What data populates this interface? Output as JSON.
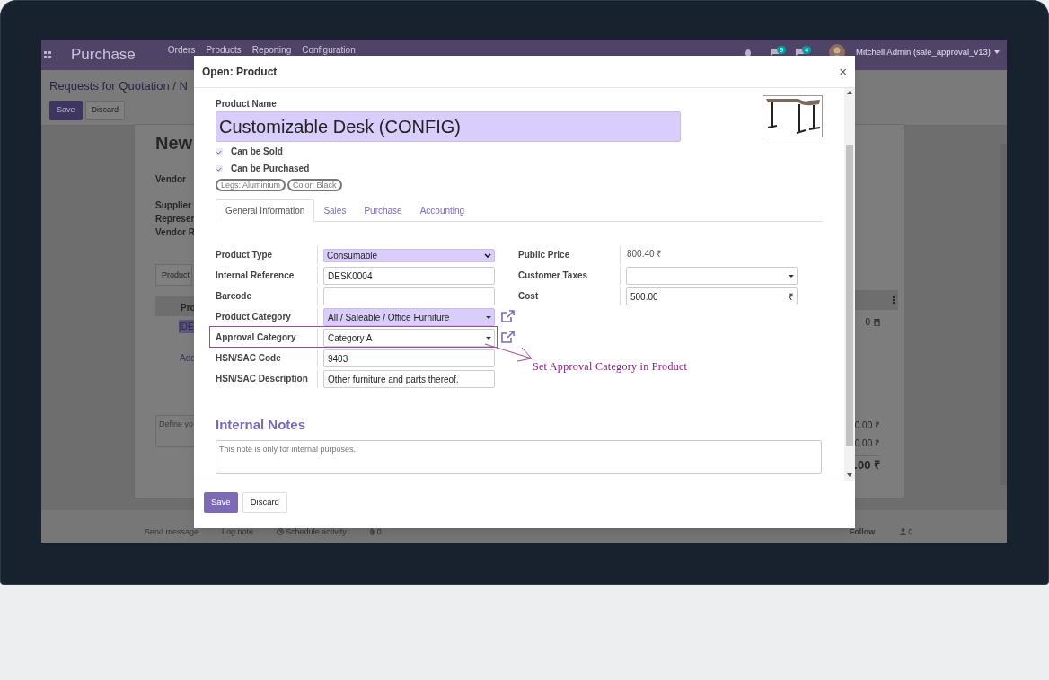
{
  "app": {
    "title": "Purchase",
    "menu": [
      "Orders",
      "Products",
      "Reporting",
      "Configuration"
    ],
    "badges": [
      "9",
      "4"
    ],
    "user": "Mitchell Admin (sale_approval_v13)"
  },
  "background": {
    "breadcrumb": "Requests for Quotation / N",
    "buttons": [
      "Save",
      "Discard"
    ],
    "record_title": "New",
    "labels": [
      "Vendor",
      "Supplier",
      "Represer",
      "Vendor R"
    ],
    "tab": "Product",
    "table_header": "Pro",
    "line_product": "[DE",
    "line_amount": "0",
    "add_line": "Add",
    "notes_placeholder": "Define yo",
    "totals": [
      "0.00 ₹",
      "0.00 ₹",
      ".00 ₹"
    ],
    "chatter": [
      "Send message",
      "Log note",
      "Schedule activity",
      "0"
    ],
    "follow": "Follow",
    "followers": "0"
  },
  "dialog": {
    "title": "Open: Product",
    "close": "×",
    "name_label": "Product Name",
    "name": "Customizable Desk (CONFIG)",
    "checkboxes": [
      {
        "label": "Can be Sold",
        "checked": true
      },
      {
        "label": "Can be Purchased",
        "checked": true
      }
    ],
    "attributes": [
      "Legs: Aluminium",
      "Color: Black"
    ],
    "tabs": [
      {
        "label": "General Information",
        "selected": true
      },
      {
        "label": "Sales",
        "selected": false
      },
      {
        "label": "Purchase",
        "selected": false
      },
      {
        "label": "Accounting",
        "selected": false
      }
    ],
    "fields_left": [
      {
        "label": "Product Type",
        "kind": "select",
        "value": "Consumable",
        "required": true,
        "link": false,
        "annotated": false
      },
      {
        "label": "Internal Reference",
        "kind": "input",
        "value": "DESK0004",
        "required": false,
        "link": false,
        "annotated": false
      },
      {
        "label": "Barcode",
        "kind": "input",
        "required": false,
        "link": false,
        "annotated": false
      },
      {
        "label": "Product Category",
        "kind": "many2one",
        "value": "All / Saleable / Office Furniture",
        "required": true,
        "link": true,
        "annotated": false
      },
      {
        "label": "Approval Category",
        "kind": "many2one",
        "value": "Category A",
        "required": false,
        "link": true,
        "annotated": true
      },
      {
        "label": "HSN/SAC Code",
        "kind": "input",
        "value": "9403",
        "required": false,
        "link": false,
        "annotated": false
      },
      {
        "label": "HSN/SAC Description",
        "kind": "input",
        "value": "Other furniture and parts thereof.",
        "required": false,
        "link": false,
        "annotated": false
      }
    ],
    "fields_right": [
      {
        "label": "Public Price",
        "kind": "text",
        "value": "800.40 ₹"
      },
      {
        "label": "Customer Taxes",
        "kind": "many2one"
      },
      {
        "label": "Cost",
        "kind": "monetary",
        "value": "500.00",
        "currency": "₹"
      }
    ],
    "annotation": "Set Approval Category in Product",
    "notes_heading": "Internal Notes",
    "notes_placeholder": "This note is only for internal purposes.",
    "buttons": [
      {
        "label": "Save",
        "primary": true
      },
      {
        "label": "Discard",
        "primary": false
      }
    ]
  }
}
